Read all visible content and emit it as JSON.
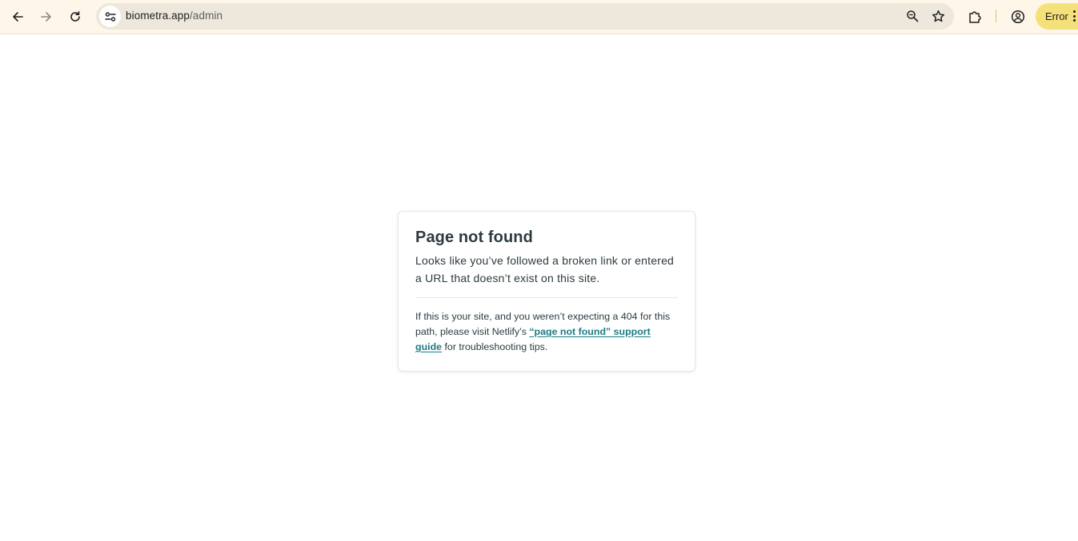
{
  "browser": {
    "url_host": "biometra.app",
    "url_path": "/admin",
    "error_chip_label": "Error",
    "colors": {
      "toolbar_bg": "#fdf6e9",
      "omnibox_bg": "#ede7dc",
      "error_chip_bg": "#f5e17a"
    },
    "icons": [
      "back-arrow-icon",
      "forward-arrow-icon",
      "reload-icon",
      "site-info-icon",
      "zoom-icon",
      "star-icon",
      "extensions-icon",
      "profile-icon",
      "kebab-menu-icon"
    ]
  },
  "page": {
    "title": "Page not found",
    "lead": "Looks like you’ve followed a broken link or entered a URL that doesn’t exist on this site.",
    "note_before": "If this is your site, and you weren’t expecting a 404 for this path, please visit Netlify’s ",
    "note_link": "“page not found” support guide",
    "note_after": " for troubleshooting tips.",
    "colors": {
      "text": "#2d3b41",
      "link": "#1c7b83"
    }
  }
}
